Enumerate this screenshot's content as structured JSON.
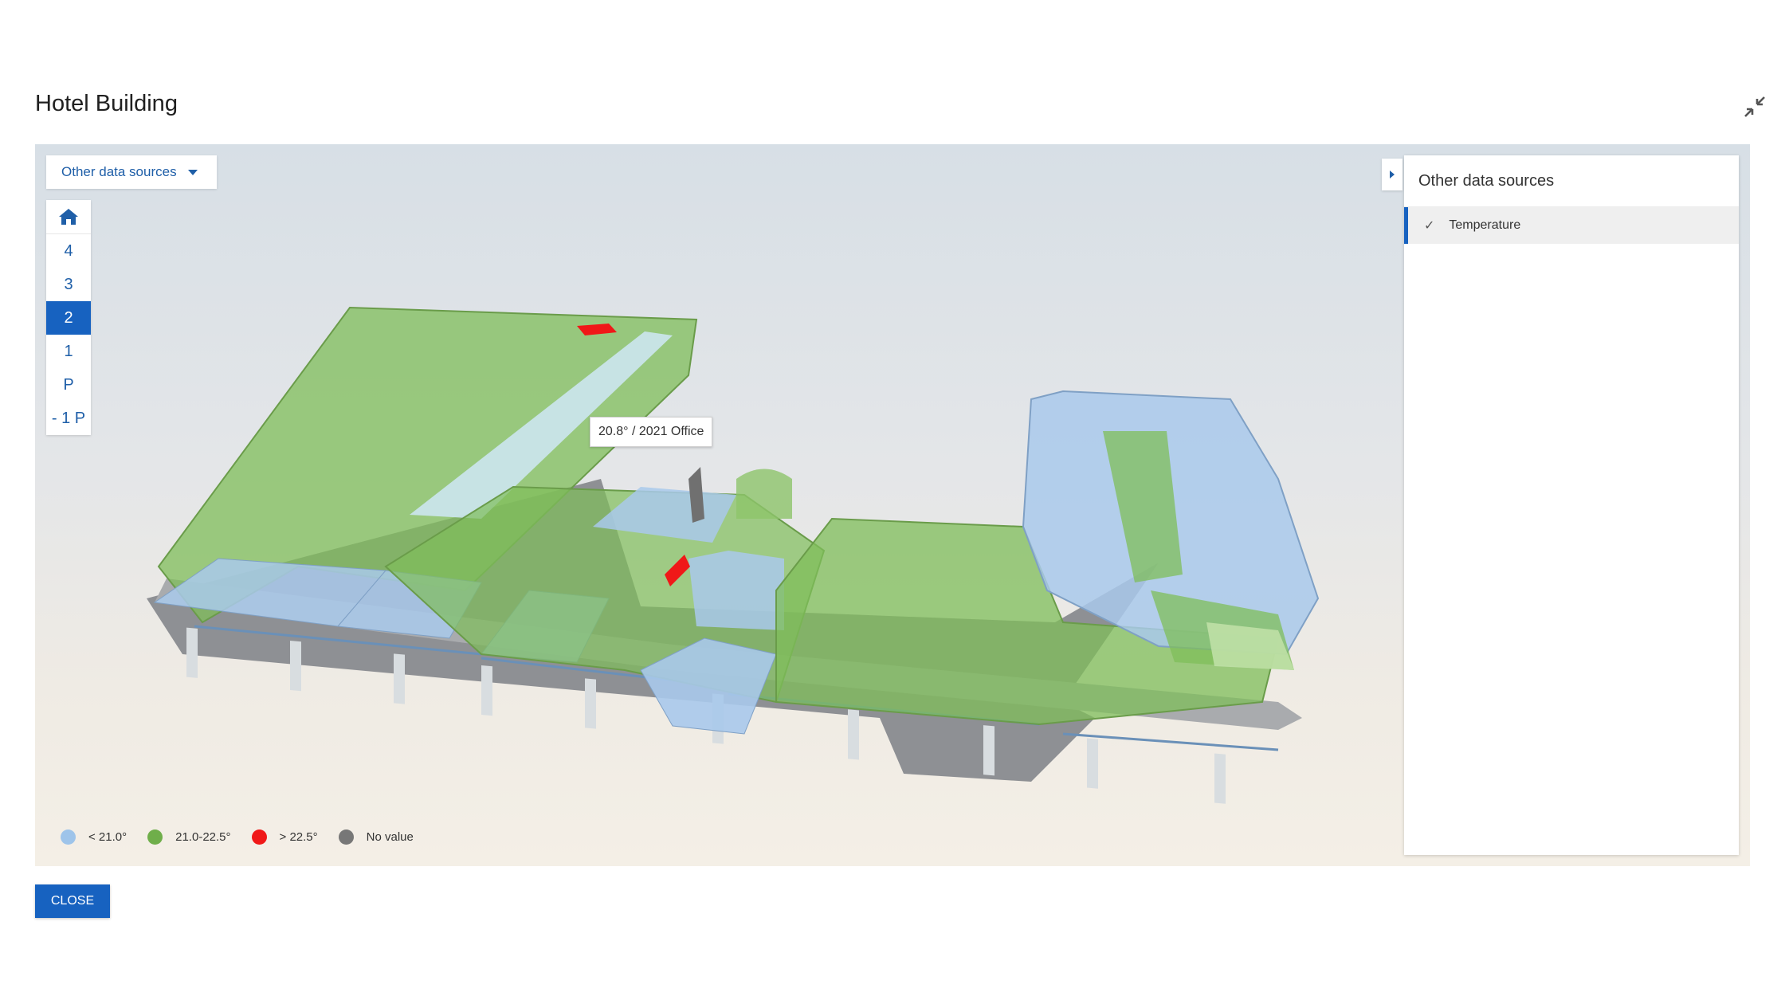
{
  "title": "Hotel Building",
  "toolbar": {
    "data_sources_label": "Other data sources"
  },
  "floors": [
    "4",
    "3",
    "2",
    "1",
    "P",
    "- 1 P"
  ],
  "active_floor": "2",
  "tooltip": "20.8° / 2021 Office",
  "legend": [
    {
      "label": "< 21.0°",
      "color": "#9ec4ea"
    },
    {
      "label": "21.0-22.5°",
      "color": "#6fae4a"
    },
    {
      "label": "> 22.5°",
      "color": "#f01818"
    },
    {
      "label": "No value",
      "color": "#777777"
    }
  ],
  "side_panel": {
    "title": "Other data sources",
    "items": [
      {
        "label": "Temperature",
        "checked": true
      }
    ]
  },
  "close_label": "CLOSE",
  "colors": {
    "accent": "#1762c0",
    "green": "#6fae4a",
    "blue": "#9ec4ea",
    "red": "#f01818"
  },
  "icons": [
    "collapse-icon",
    "home-icon",
    "caret-down-icon",
    "chevron-right-icon",
    "check-icon"
  ]
}
